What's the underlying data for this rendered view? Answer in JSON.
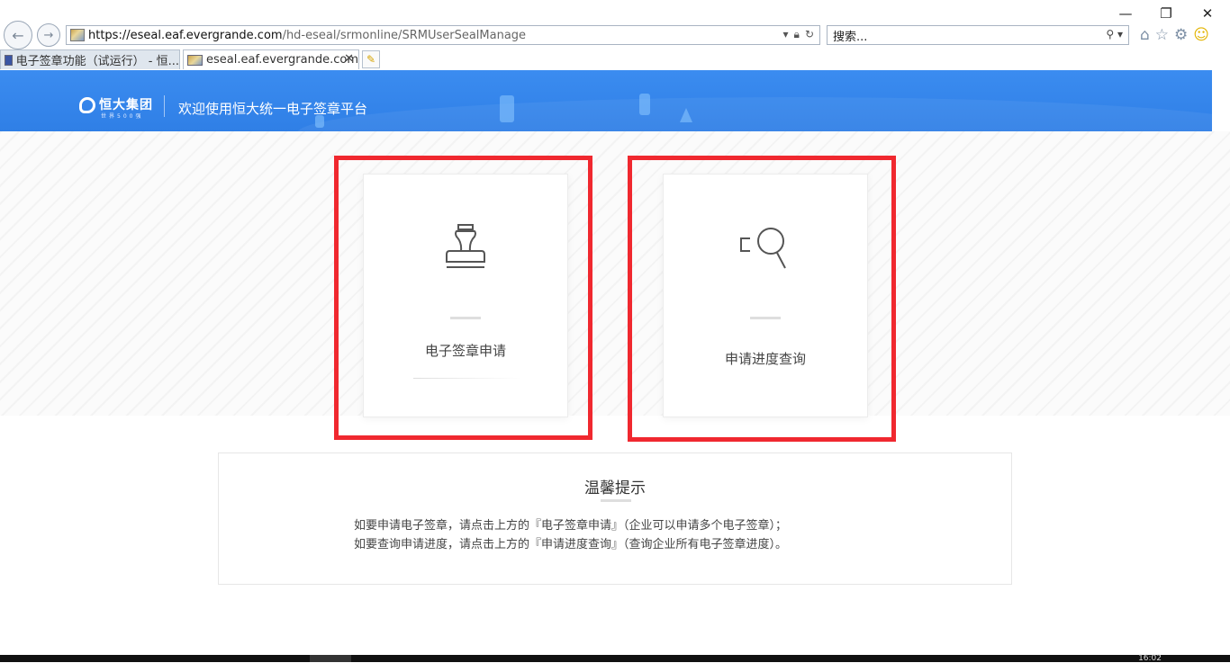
{
  "browser": {
    "url_host": "https://eseal.eaf.evergrande.com",
    "url_path": "/hd-eseal/srmonline/SRMUserSealManage",
    "search_placeholder": "搜索...",
    "tabs": [
      {
        "label": "电子签章功能（试运行） - 恒...",
        "active": false
      },
      {
        "label": "eseal.eaf.evergrande.com",
        "active": true
      }
    ]
  },
  "header": {
    "brand_name": "恒大集团",
    "brand_sub": "世界500强",
    "welcome": "欢迎使用恒大统一电子签章平台",
    "background": "#2f7fe6"
  },
  "cards": [
    {
      "label": "电子签章申请",
      "icon": "stamp-icon"
    },
    {
      "label": "申请进度查询",
      "icon": "search-progress-icon"
    }
  ],
  "tips": {
    "title": "温馨提示",
    "line1": "如要申请电子签章，请点击上方的『电子签章申请』（企业可以申请多个电子签章）；",
    "line2": "如要查询申请进度，请点击上方的『申请进度查询』（查询企业所有电子签章进度）。"
  },
  "highlight_color": "#f0282f",
  "taskbar": {
    "clock": "16:02"
  }
}
